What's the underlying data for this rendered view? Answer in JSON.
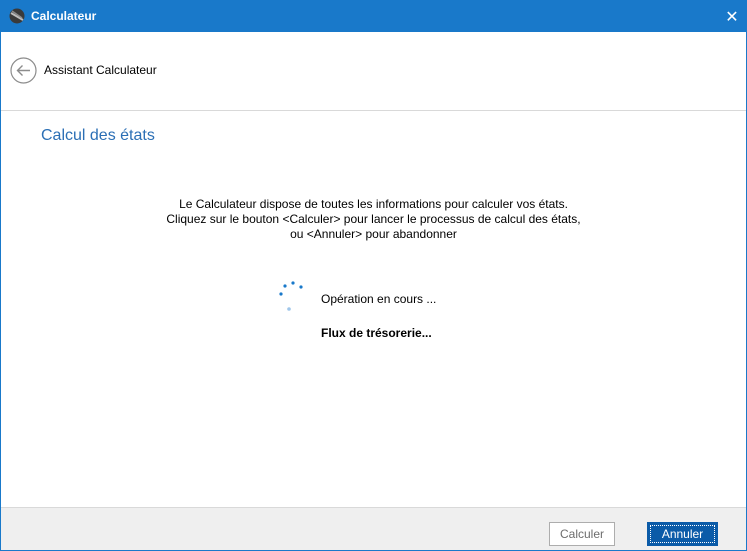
{
  "window": {
    "title": "Calculateur",
    "close_glyph": "✕"
  },
  "nav": {
    "title": "Assistant Calculateur",
    "back_icon": "arrow-left-circle"
  },
  "content": {
    "heading": "Calcul des états",
    "description_lines": [
      "Le Calculateur dispose de toutes les informations pour calculer vos états.",
      "Cliquez sur le bouton <Calculer> pour lancer le processus de calcul des états,",
      "ou <Annuler> pour abandonner"
    ],
    "status": "Opération en cours ...",
    "step": "Flux de trésorerie..."
  },
  "footer": {
    "calculate_label": "Calculer",
    "cancel_label": "Annuler"
  },
  "colors": {
    "accent": "#1979ca",
    "heading": "#2b6fb5",
    "primary_button": "#0b5ba8"
  }
}
